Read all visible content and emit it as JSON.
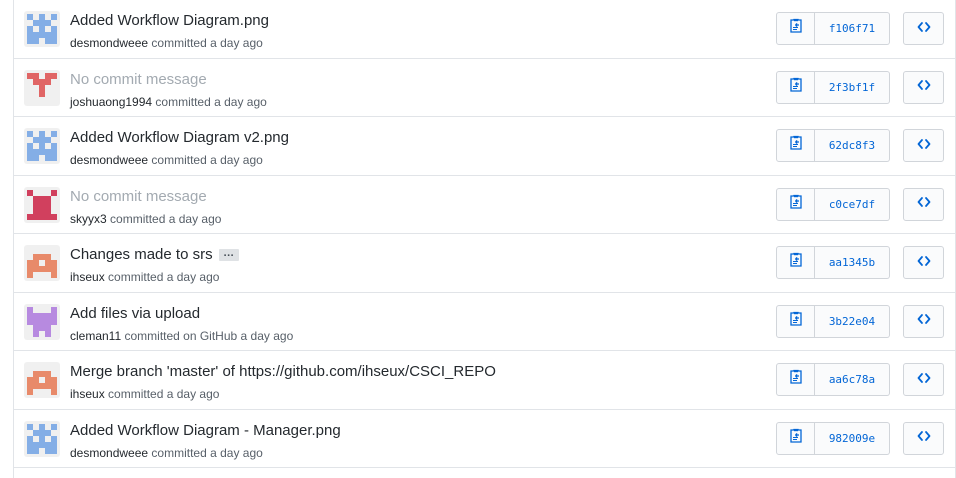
{
  "commits": [
    {
      "title": "Added Workflow Diagram.png",
      "author": "desmondweee",
      "committed_text": "committed a day ago",
      "sha": "f106f71",
      "avatar": "identicon-blue-h",
      "avatar_color": "#84aee6",
      "has_message": true
    },
    {
      "title": "No commit message",
      "author": "joshuaong1994",
      "committed_text": "committed a day ago",
      "sha": "2f3bf1f",
      "avatar": "identicon-red-y",
      "avatar_color": "#e06565",
      "has_message": false
    },
    {
      "title": "Added Workflow Diagram v2.png",
      "author": "desmondweee",
      "committed_text": "committed a day ago",
      "sha": "62dc8f3",
      "avatar": "identicon-blue-h",
      "avatar_color": "#84aee6",
      "has_message": true
    },
    {
      "title": "No commit message",
      "author": "skyyx3",
      "committed_text": "committed a day ago",
      "sha": "c0ce7df",
      "avatar": "identicon-crimson",
      "avatar_color": "#d1405e",
      "has_message": false
    },
    {
      "title": "Changes made to srs",
      "author": "ihseux",
      "committed_text": "committed a day ago",
      "sha": "aa1345b",
      "avatar": "identicon-salmon",
      "avatar_color": "#e88a6a",
      "has_message": true,
      "has_ellipsis": true,
      "ellipsis_label": "…"
    },
    {
      "title": "Add files via upload",
      "author": "cleman11",
      "committed_text": "committed on GitHub a day ago",
      "sha": "3b22e04",
      "avatar": "identicon-purple",
      "avatar_color": "#b78ae0",
      "has_message": true
    },
    {
      "title": "Merge branch 'master' of https://github.com/ihseux/CSCI_REPO",
      "author": "ihseux",
      "committed_text": "committed a day ago",
      "sha": "aa6c78a",
      "avatar": "identicon-salmon",
      "avatar_color": "#e88a6a",
      "has_message": true
    },
    {
      "title": "Added Workflow Diagram - Manager.png",
      "author": "desmondweee",
      "committed_text": "committed a day ago",
      "sha": "982009e",
      "avatar": "identicon-blue-h",
      "avatar_color": "#84aee6",
      "has_message": true
    }
  ],
  "icons": {
    "copy": "clippy-icon",
    "browse": "code-icon"
  },
  "colors": {
    "link": "#0366d6",
    "border": "#d1d5da",
    "muted_title": "#a3aab1"
  }
}
